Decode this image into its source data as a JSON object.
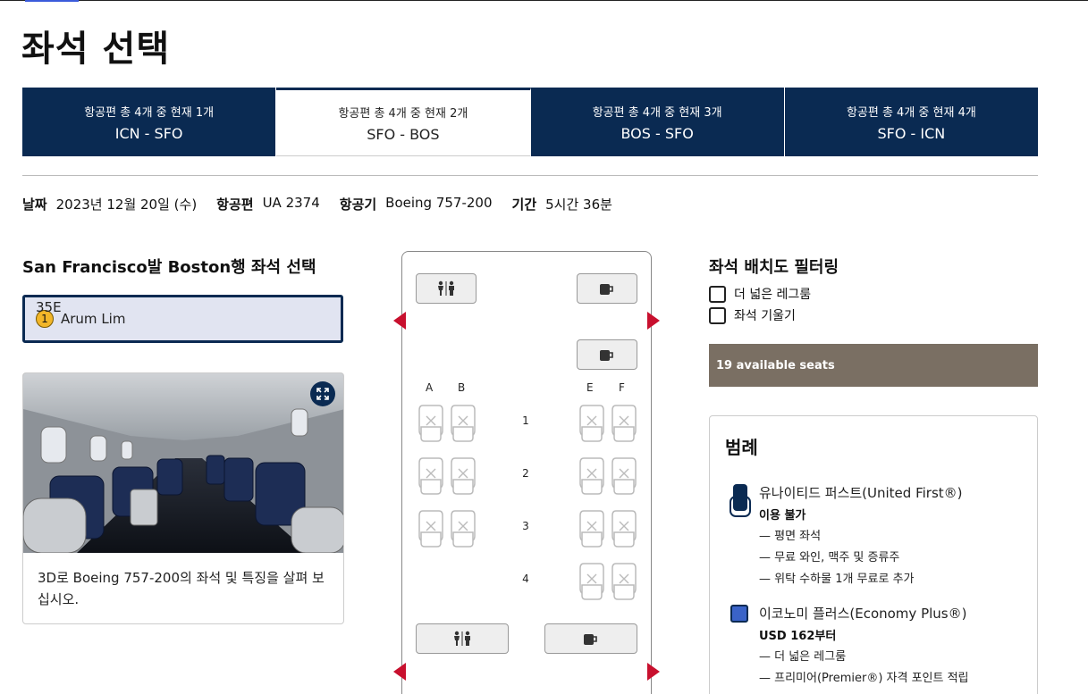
{
  "page": {
    "title": "좌석 선택"
  },
  "tabs": [
    {
      "sub": "항공편 총 4개 중 현재 1개",
      "route": "ICN - SFO",
      "active": false
    },
    {
      "sub": "항공편 총 4개 중 현재 2개",
      "route": "SFO - BOS",
      "active": true
    },
    {
      "sub": "항공편 총 4개 중 현재 3개",
      "route": "BOS - SFO",
      "active": false
    },
    {
      "sub": "항공편 총 4개 중 현재 4개",
      "route": "SFO - ICN",
      "active": false
    }
  ],
  "info": {
    "date_label": "날짜",
    "date_value": "2023년 12월 20일 (수)",
    "flight_label": "항공편",
    "flight_value": "UA 2374",
    "aircraft_label": "항공기",
    "aircraft_value": "Boeing 757-200",
    "duration_label": "기간",
    "duration_value": "5시간 36분"
  },
  "left": {
    "heading": "San Francisco발 Boston행 좌석 선택",
    "traveler": {
      "number": "1",
      "name": "Arum Lim",
      "seat": "35E"
    },
    "card_desc": "3D로 Boeing 757-200의 좌석 및 특징을 살펴 보십시오."
  },
  "seatmap": {
    "columns": [
      "A",
      "B",
      "E",
      "F"
    ],
    "rows": [
      "1",
      "2",
      "3",
      "4"
    ],
    "facility_icons": [
      "lavatory-icon",
      "galley-icon"
    ]
  },
  "filters": {
    "heading": "좌석 배치도 필터링",
    "options": [
      "더 넓은 레그룸",
      "좌석 기울기"
    ],
    "available": "19 available seats"
  },
  "legend": {
    "heading": "범례",
    "first": {
      "title": "유나이티드 퍼스트(United First®)",
      "sub": "이용 불가",
      "items": [
        "— 평면 좌석",
        "— 무료 와인, 맥주 및 증류주",
        "— 위탁 수하물 1개 무료로 추가"
      ],
      "color": "#0a2a52"
    },
    "plus": {
      "title": "이코노미 플러스(Economy Plus®)",
      "sub": "USD 162부터",
      "items": [
        "— 더 넓은 레그룸",
        "— 프리미어(Premier®) 자격 포인트 적립"
      ],
      "color": "#3a63c8"
    }
  },
  "colors": {
    "navy": "#0a2a52",
    "exit": "#c8102e",
    "available_bar": "#7a6f63"
  }
}
